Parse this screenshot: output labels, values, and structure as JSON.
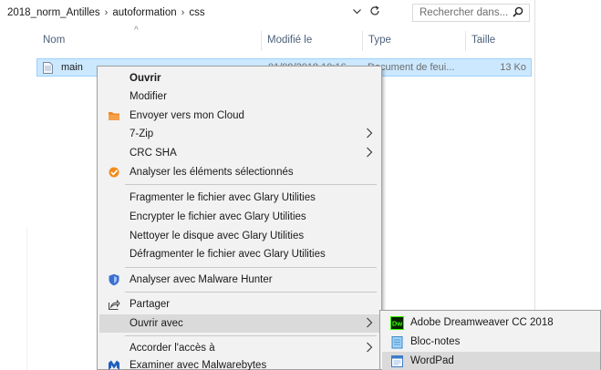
{
  "address": {
    "crumbs": [
      "2018_norm_Antilles",
      "autoformation",
      "css"
    ],
    "search_placeholder": "Rechercher dans..."
  },
  "columns": {
    "name": "Nom",
    "modified": "Modifié le",
    "type": "Type",
    "size": "Taille"
  },
  "file": {
    "name": "main",
    "modified": "01/09/2018 10:16",
    "type": "Document de feui...",
    "size": "13 Ko"
  },
  "context_menu": {
    "open": "Ouvrir",
    "edit": "Modifier",
    "send_cloud": "Envoyer vers mon Cloud",
    "sevenzip": "7-Zip",
    "crc": "CRC SHA",
    "analyze_selected": "Analyser les éléments sélectionnés",
    "glary_fragment": "Fragmenter le fichier avec Glary Utilities",
    "glary_encrypt": "Encrypter le fichier avec Glary Utilities",
    "glary_clean": "Nettoyer le disque avec Glary Utilities",
    "glary_defrag": "Défragmenter le fichier avec Glary Utilities",
    "malware_hunter": "Analyser avec Malware Hunter",
    "share": "Partager",
    "open_with": "Ouvrir avec",
    "grant_access": "Accorder l'accès à",
    "malwarebytes": "Examiner avec Malwarebytes"
  },
  "open_with_menu": {
    "dreamweaver": "Adobe Dreamweaver CC 2018",
    "dreamweaver_badge": "Dw",
    "notepad": "Bloc-notes",
    "wordpad": "WordPad"
  },
  "colors": {
    "selection": "#cce8ff",
    "selection_border": "#99d1ff",
    "menu_bg": "#f2f2f2",
    "menu_highlight": "#dadada",
    "header_text": "#4c607a"
  }
}
